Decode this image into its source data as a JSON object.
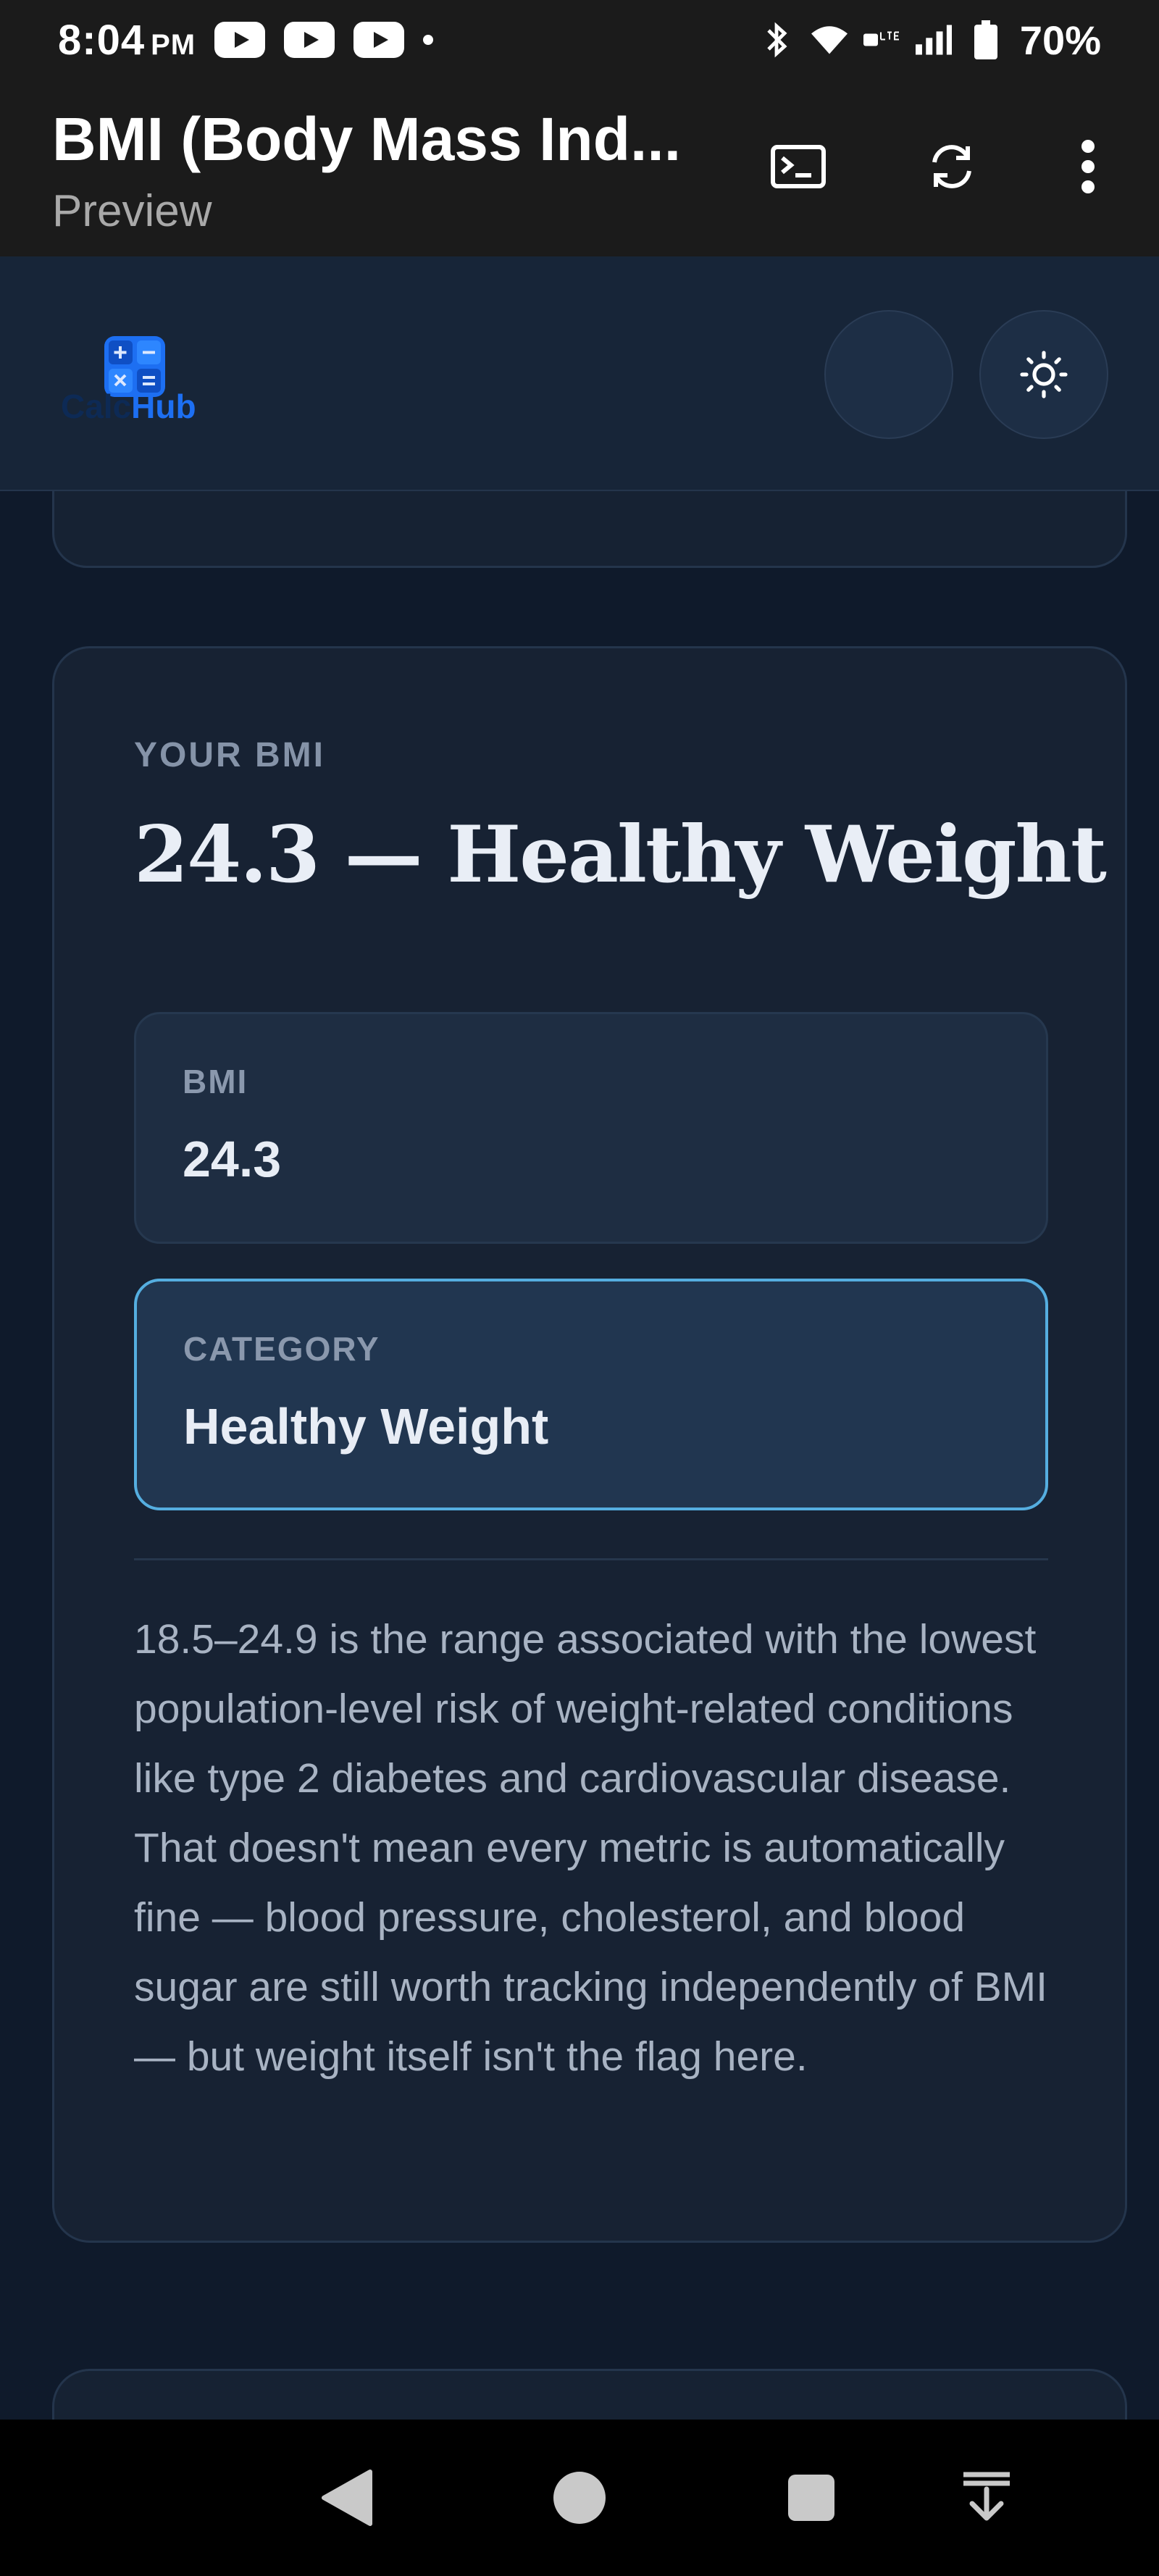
{
  "status_bar": {
    "time": "8:04",
    "ampm": "PM",
    "battery": "70%",
    "icons": [
      "youtube-icon",
      "youtube-icon",
      "youtube-icon",
      "notification-dot-icon",
      "bluetooth-icon",
      "wifi-icon",
      "hd-lte-icon",
      "signal-icon",
      "battery-icon"
    ]
  },
  "app_bar": {
    "title": "BMI (Body Mass Ind...",
    "subtitle": "Preview",
    "actions": [
      "terminal-icon",
      "refresh-icon",
      "more-vert-icon"
    ]
  },
  "site_header": {
    "logo_part1": "Calc",
    "logo_part2": "Hub",
    "accent": "#1d6ff2"
  },
  "result": {
    "eyebrow": "YOUR BMI",
    "headline": "24.3 — Healthy Weight",
    "bmi_label": "BMI",
    "bmi_value": "24.3",
    "category_label": "CATEGORY",
    "category_value": "Healthy Weight",
    "description": "18.5–24.9 is the range associated with the lowest population-level risk of weight-related conditions like type 2 diabetes and cardiovascular disease. That doesn't mean every metric is automatically fine — blood pressure, cholesterol, and blood sugar are still worth tracking independently of BMI — but weight itself isn't the flag here.",
    "category_border": "#55aee0"
  },
  "nav_bar": {
    "buttons": [
      "back-icon",
      "home-icon",
      "recents-icon",
      "download-icon"
    ]
  }
}
